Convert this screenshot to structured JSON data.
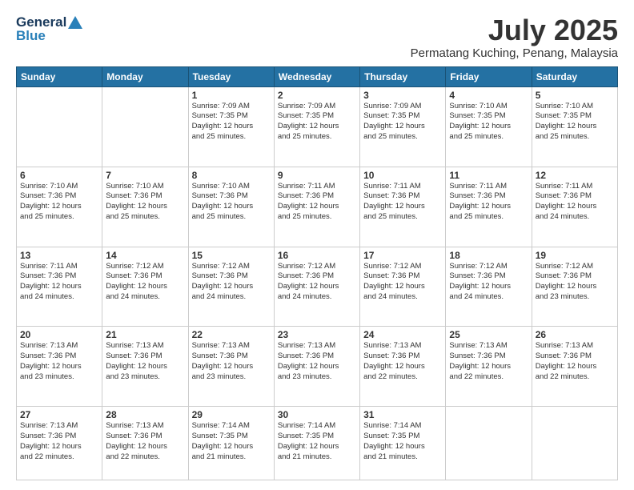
{
  "header": {
    "logo_general": "General",
    "logo_blue": "Blue",
    "month_year": "July 2025",
    "location": "Permatang Kuching, Penang, Malaysia"
  },
  "weekdays": [
    "Sunday",
    "Monday",
    "Tuesday",
    "Wednesday",
    "Thursday",
    "Friday",
    "Saturday"
  ],
  "weeks": [
    [
      {
        "day": "",
        "info": ""
      },
      {
        "day": "",
        "info": ""
      },
      {
        "day": "1",
        "info": "Sunrise: 7:09 AM\nSunset: 7:35 PM\nDaylight: 12 hours\nand 25 minutes."
      },
      {
        "day": "2",
        "info": "Sunrise: 7:09 AM\nSunset: 7:35 PM\nDaylight: 12 hours\nand 25 minutes."
      },
      {
        "day": "3",
        "info": "Sunrise: 7:09 AM\nSunset: 7:35 PM\nDaylight: 12 hours\nand 25 minutes."
      },
      {
        "day": "4",
        "info": "Sunrise: 7:10 AM\nSunset: 7:35 PM\nDaylight: 12 hours\nand 25 minutes."
      },
      {
        "day": "5",
        "info": "Sunrise: 7:10 AM\nSunset: 7:35 PM\nDaylight: 12 hours\nand 25 minutes."
      }
    ],
    [
      {
        "day": "6",
        "info": "Sunrise: 7:10 AM\nSunset: 7:36 PM\nDaylight: 12 hours\nand 25 minutes."
      },
      {
        "day": "7",
        "info": "Sunrise: 7:10 AM\nSunset: 7:36 PM\nDaylight: 12 hours\nand 25 minutes."
      },
      {
        "day": "8",
        "info": "Sunrise: 7:10 AM\nSunset: 7:36 PM\nDaylight: 12 hours\nand 25 minutes."
      },
      {
        "day": "9",
        "info": "Sunrise: 7:11 AM\nSunset: 7:36 PM\nDaylight: 12 hours\nand 25 minutes."
      },
      {
        "day": "10",
        "info": "Sunrise: 7:11 AM\nSunset: 7:36 PM\nDaylight: 12 hours\nand 25 minutes."
      },
      {
        "day": "11",
        "info": "Sunrise: 7:11 AM\nSunset: 7:36 PM\nDaylight: 12 hours\nand 25 minutes."
      },
      {
        "day": "12",
        "info": "Sunrise: 7:11 AM\nSunset: 7:36 PM\nDaylight: 12 hours\nand 24 minutes."
      }
    ],
    [
      {
        "day": "13",
        "info": "Sunrise: 7:11 AM\nSunset: 7:36 PM\nDaylight: 12 hours\nand 24 minutes."
      },
      {
        "day": "14",
        "info": "Sunrise: 7:12 AM\nSunset: 7:36 PM\nDaylight: 12 hours\nand 24 minutes."
      },
      {
        "day": "15",
        "info": "Sunrise: 7:12 AM\nSunset: 7:36 PM\nDaylight: 12 hours\nand 24 minutes."
      },
      {
        "day": "16",
        "info": "Sunrise: 7:12 AM\nSunset: 7:36 PM\nDaylight: 12 hours\nand 24 minutes."
      },
      {
        "day": "17",
        "info": "Sunrise: 7:12 AM\nSunset: 7:36 PM\nDaylight: 12 hours\nand 24 minutes."
      },
      {
        "day": "18",
        "info": "Sunrise: 7:12 AM\nSunset: 7:36 PM\nDaylight: 12 hours\nand 24 minutes."
      },
      {
        "day": "19",
        "info": "Sunrise: 7:12 AM\nSunset: 7:36 PM\nDaylight: 12 hours\nand 23 minutes."
      }
    ],
    [
      {
        "day": "20",
        "info": "Sunrise: 7:13 AM\nSunset: 7:36 PM\nDaylight: 12 hours\nand 23 minutes."
      },
      {
        "day": "21",
        "info": "Sunrise: 7:13 AM\nSunset: 7:36 PM\nDaylight: 12 hours\nand 23 minutes."
      },
      {
        "day": "22",
        "info": "Sunrise: 7:13 AM\nSunset: 7:36 PM\nDaylight: 12 hours\nand 23 minutes."
      },
      {
        "day": "23",
        "info": "Sunrise: 7:13 AM\nSunset: 7:36 PM\nDaylight: 12 hours\nand 23 minutes."
      },
      {
        "day": "24",
        "info": "Sunrise: 7:13 AM\nSunset: 7:36 PM\nDaylight: 12 hours\nand 22 minutes."
      },
      {
        "day": "25",
        "info": "Sunrise: 7:13 AM\nSunset: 7:36 PM\nDaylight: 12 hours\nand 22 minutes."
      },
      {
        "day": "26",
        "info": "Sunrise: 7:13 AM\nSunset: 7:36 PM\nDaylight: 12 hours\nand 22 minutes."
      }
    ],
    [
      {
        "day": "27",
        "info": "Sunrise: 7:13 AM\nSunset: 7:36 PM\nDaylight: 12 hours\nand 22 minutes."
      },
      {
        "day": "28",
        "info": "Sunrise: 7:13 AM\nSunset: 7:36 PM\nDaylight: 12 hours\nand 22 minutes."
      },
      {
        "day": "29",
        "info": "Sunrise: 7:14 AM\nSunset: 7:35 PM\nDaylight: 12 hours\nand 21 minutes."
      },
      {
        "day": "30",
        "info": "Sunrise: 7:14 AM\nSunset: 7:35 PM\nDaylight: 12 hours\nand 21 minutes."
      },
      {
        "day": "31",
        "info": "Sunrise: 7:14 AM\nSunset: 7:35 PM\nDaylight: 12 hours\nand 21 minutes."
      },
      {
        "day": "",
        "info": ""
      },
      {
        "day": "",
        "info": ""
      }
    ]
  ]
}
